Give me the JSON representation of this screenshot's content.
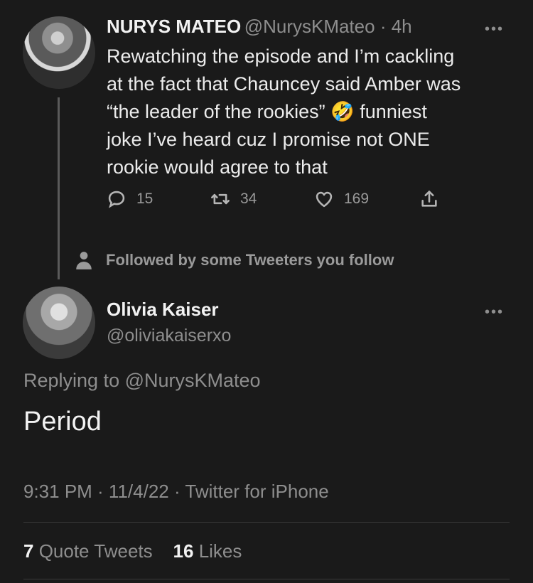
{
  "original_tweet": {
    "display_name": "NURYS MATEO",
    "handle": "@NurysKMateo",
    "separator": " · ",
    "time": "4h",
    "more": "•••",
    "text_lines": [
      "Rewatching the episode and I’m cackling",
      "at the fact that Chauncey said Amber was",
      "“the leader of the rookies” 🤣 funniest",
      "joke I’ve heard cuz I promise not ONE",
      "rookie would agree to that"
    ],
    "replies_count": "15",
    "retweets_count": "34",
    "likes_count": "169",
    "followed_by": "Followed by some Tweeters you follow"
  },
  "reply_tweet": {
    "display_name": "Olivia Kaiser",
    "handle": "@oliviakaiserxo",
    "more": "•••",
    "replying_prefix": "Replying to ",
    "replying_to": "@NurysKMateo",
    "text": "Period",
    "meta": "9:31 PM · 11/4/22 · Twitter for iPhone",
    "quote_tweets_count": "7",
    "quote_tweets_label": " Quote Tweets",
    "likes_count": "16",
    "likes_label": " Likes"
  },
  "icons": {
    "reply": "speech-bubble-icon",
    "retweet": "retweet-icon",
    "like": "heart-icon",
    "share": "share-icon",
    "person": "person-icon"
  }
}
